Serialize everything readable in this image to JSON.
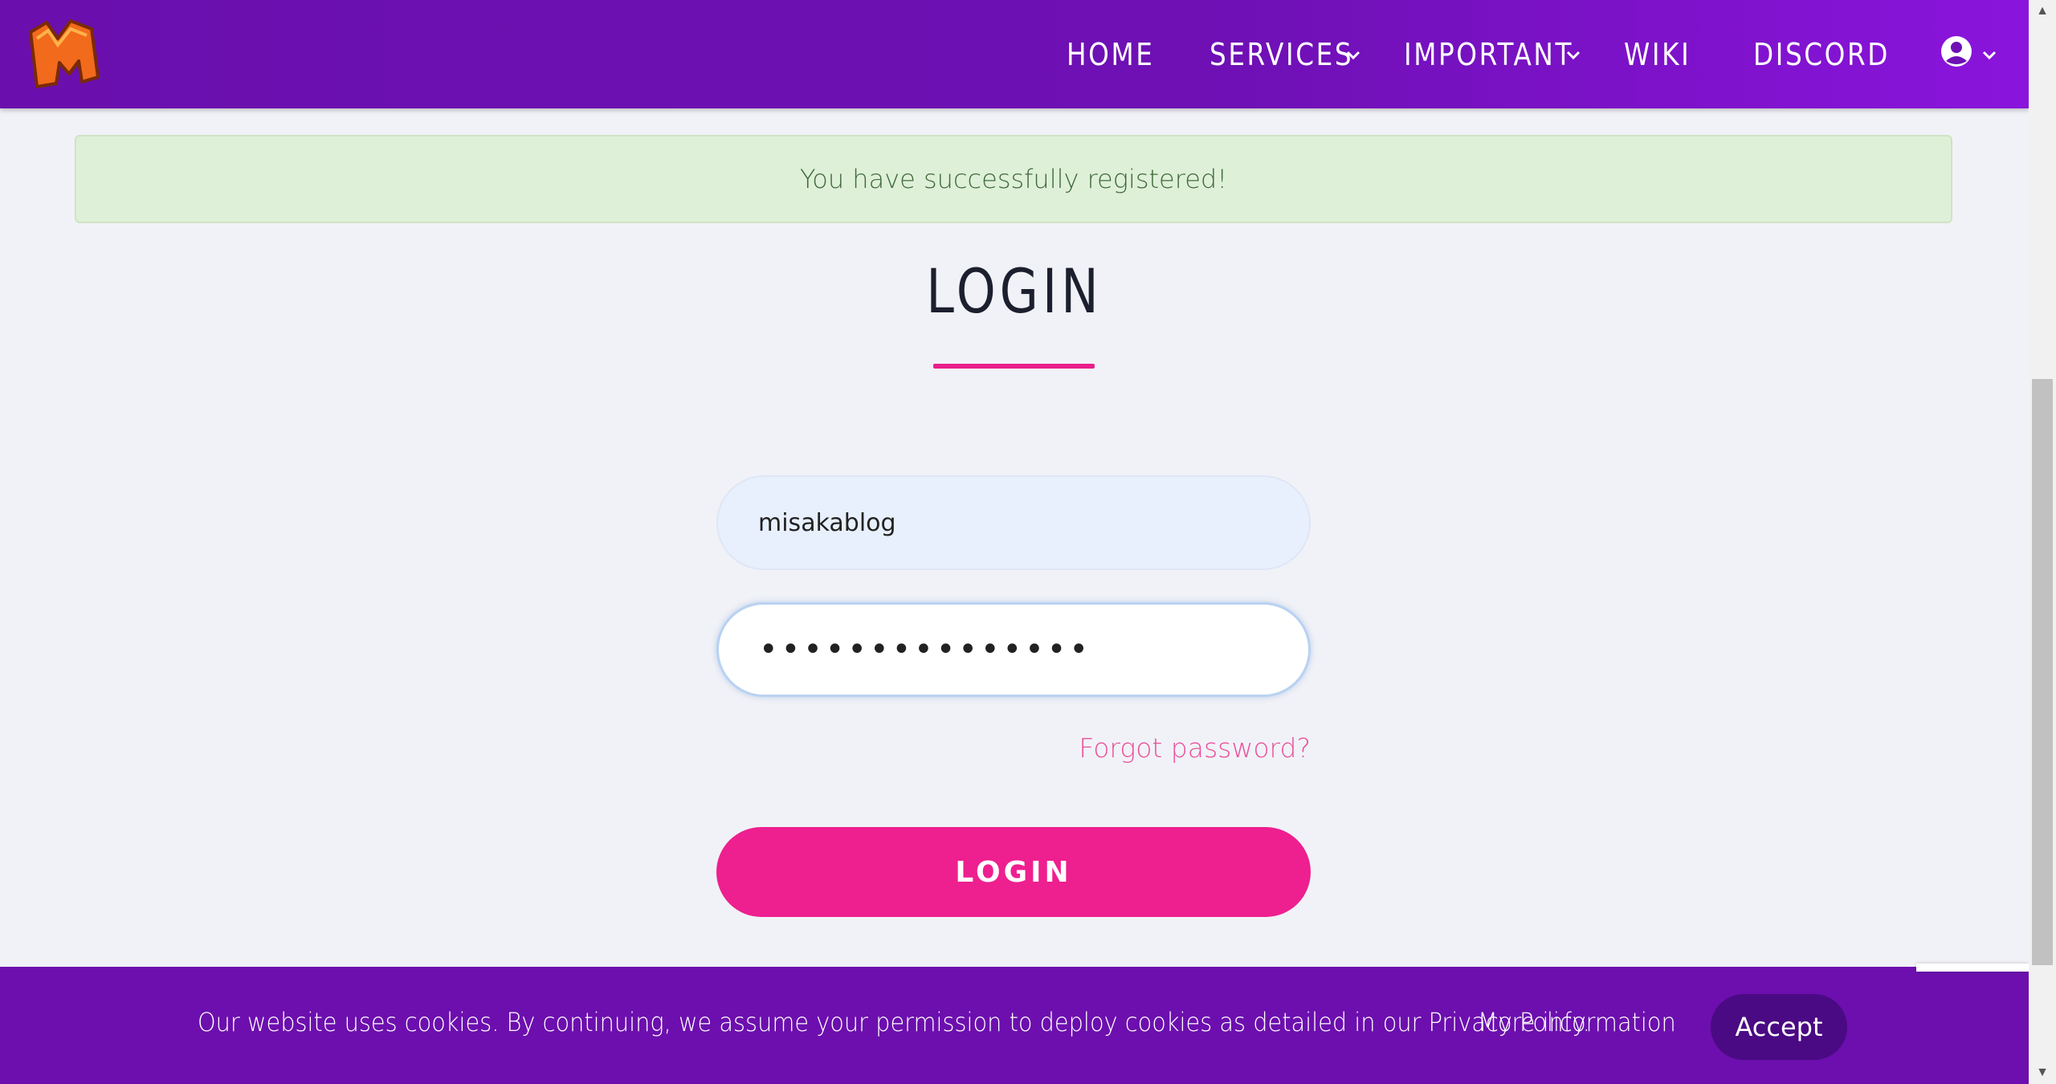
{
  "nav": {
    "items": [
      {
        "label": "HOME",
        "has_dropdown": false
      },
      {
        "label": "SERVICES",
        "has_dropdown": true
      },
      {
        "label": "IMPORTANT",
        "has_dropdown": true
      },
      {
        "label": "WIKI",
        "has_dropdown": false
      },
      {
        "label": "DISCORD",
        "has_dropdown": false
      }
    ],
    "user_icon": "user-circle-icon",
    "logo": "m-logo"
  },
  "alert": {
    "message": "You have successfully registered!"
  },
  "login": {
    "title": "LOGIN",
    "username_value": "misakablog",
    "password_value": "•••••••••••••••",
    "forgot_label": "Forgot password?",
    "button_label": "LOGIN"
  },
  "cookie": {
    "text": "Our website uses cookies. By continuing, we assume your permission to deploy cookies as detailed in our Privacy Policy.",
    "more_info": "More information",
    "accept": "Accept"
  },
  "colors": {
    "nav_bg": "#6e10b4",
    "accent": "#ee1f8f",
    "alert_bg": "#dff0d8"
  }
}
